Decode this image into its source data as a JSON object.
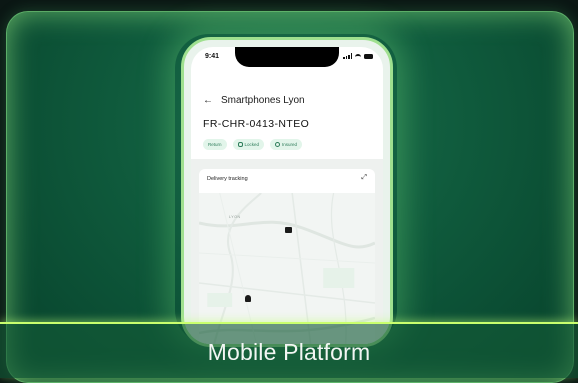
{
  "phone": {
    "status_time": "9:41",
    "nav_title": "Smartphones Lyon",
    "item_code": "FR-CHR-0413-NTEO",
    "badges": [
      "Return",
      "Locked",
      "Insured"
    ],
    "tracking_title": "Delivery tracking",
    "map_label": "LYON"
  },
  "footer": {
    "label": "Mobile Platform"
  },
  "colors": {
    "card_green": "#0f5a3c",
    "glow": "#9fe08f",
    "accent_line": "#c9ff6e"
  }
}
